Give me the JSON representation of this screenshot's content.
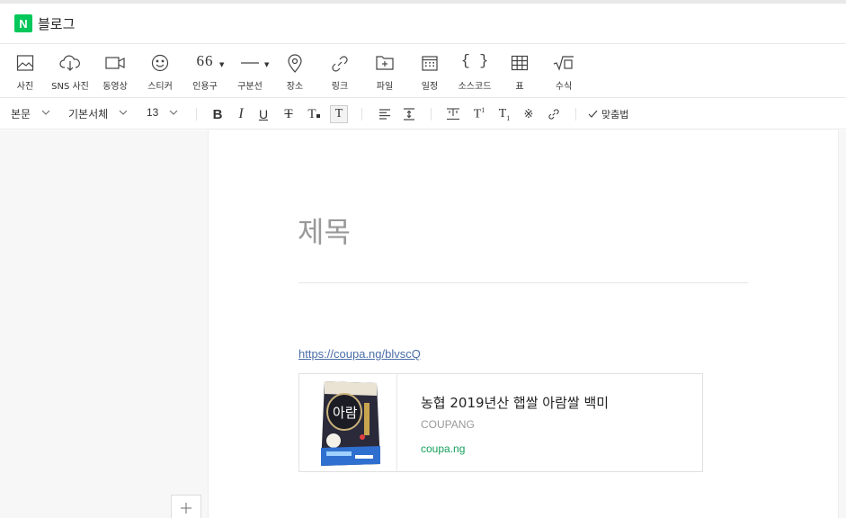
{
  "app": {
    "logo_letter": "N",
    "title": "블로그",
    "brand_color": "#03c75a"
  },
  "toolbar": {
    "photo": "사진",
    "sns_photo": "SNS 사진",
    "video": "동영상",
    "sticker": "스티커",
    "quote": "인용구",
    "divider": "구분선",
    "place": "장소",
    "link": "링크",
    "file": "파일",
    "schedule": "일정",
    "source_code": "소스코드",
    "table": "표",
    "formula": "수식",
    "quote_icon_text": "66"
  },
  "format_bar": {
    "paragraph_style": "본문",
    "font_family": "기본서체",
    "font_size": "13",
    "spellcheck": "맞춤법"
  },
  "document": {
    "title_placeholder": "제목",
    "link_url": "https://coupa.ng/blvscQ"
  },
  "og_card": {
    "title": "농협 2019년산 햅쌀 아람쌀 백미",
    "site": "COUPANG",
    "domain": "coupa.ng"
  }
}
